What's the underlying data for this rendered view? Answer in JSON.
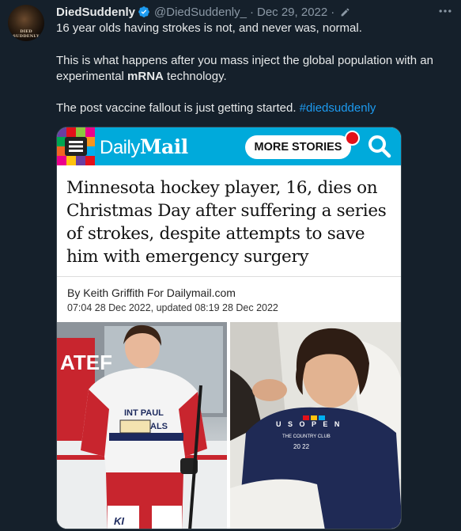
{
  "tweet": {
    "avatar_text": "DIED SUDDENLY",
    "display_name": "DiedSuddenly",
    "handle": "@DiedSuddenly_",
    "separator": "·",
    "date": "Dec 29, 2022",
    "paragraph1": "16 year olds having strokes is not, and never was, normal.",
    "paragraph2_prefix": "This is what happens after you mass inject the global population with an experimental ",
    "paragraph2_bold": "mRNA",
    "paragraph2_suffix": " technology.",
    "paragraph3": "The post vaccine fallout is just getting started. ",
    "hashtag": "#diedsuddenly"
  },
  "article": {
    "site_daily": "Daily",
    "site_mail": "Mail",
    "more_stories_label": "MORE STORIES",
    "headline": "Minnesota hockey player, 16, dies on Christmas Day after suffering a series of strokes, despite attempts to save him with emergency surgery",
    "byline": "By Keith Griffith For Dailymail.com",
    "timestamp": "07:04 28 Dec 2022, updated 08:19 28 Dec 2022"
  },
  "photos": {
    "left_sign_text": "ATEF",
    "left_jersey_text": "INT PAUL",
    "left_jersey_text2": "ALS",
    "left_sock_text": "KI",
    "right_shirt_text": "U S O P E N",
    "right_shirt_text2": "THE COUNTRY CLUB",
    "right_shirt_year": "20 22"
  },
  "colors": {
    "background": "#15202b",
    "text": "#e7e9ea",
    "muted": "#8b98a5",
    "link": "#1d9bf0",
    "verified": "#1d9bf0",
    "dailymail_blue": "#00aadb",
    "notification_red": "#e3111a"
  },
  "icons": {
    "verified": "verified-badge-icon",
    "edit": "edit-pencil-icon",
    "more": "more-horizontal-icon",
    "menu": "hamburger-menu-icon",
    "search": "search-icon"
  }
}
